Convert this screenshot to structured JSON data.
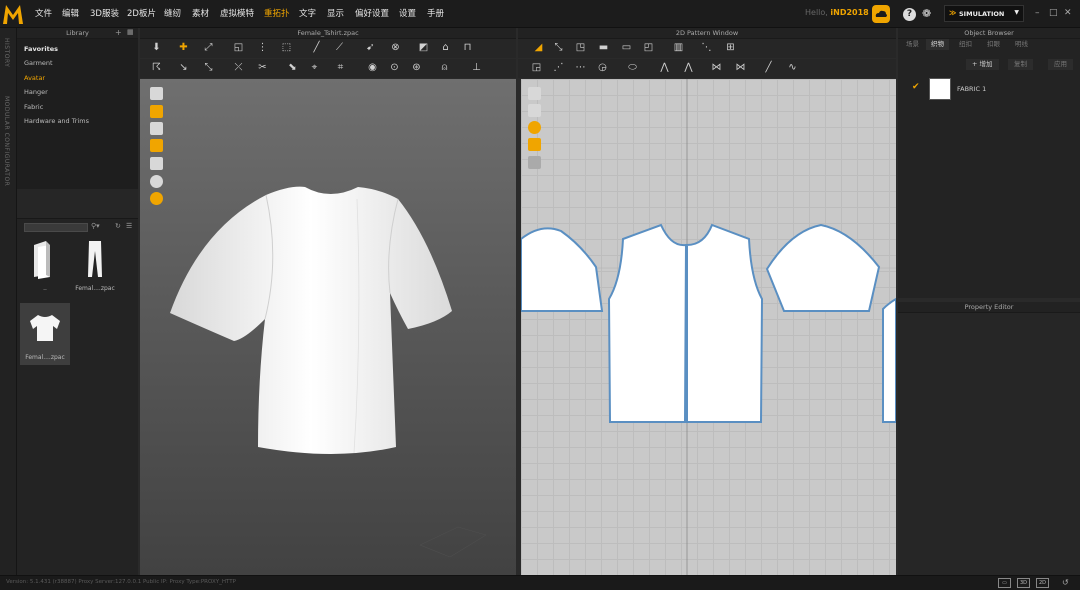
{
  "app": {
    "menus": [
      "文件",
      "编辑",
      "3D服装",
      "2D板片",
      "缝纫",
      "素材",
      "虚拟模特",
      "重拓扑",
      "文字",
      "显示",
      "偏好设置",
      "设置",
      "手册"
    ],
    "active_menu": "重拓扑",
    "user_greeting": "Hello,",
    "user_name": "iND2018",
    "mode": "SIMULATION",
    "accent_color": "#f0a500"
  },
  "left_strip": {
    "history": "HISTORY",
    "modular": "MODULAR CONFIGURATOR"
  },
  "library": {
    "title": "Library",
    "items": [
      "Favorites",
      "Garment",
      "Avatar",
      "Hanger",
      "Fabric",
      "Hardware and Trims"
    ],
    "files": [
      {
        "caption": ".."
      },
      {
        "caption": "Femal....zpac"
      },
      {
        "caption": "Femal....zpac"
      }
    ]
  },
  "view3d": {
    "title": "Female_Tshirt.zpac"
  },
  "view2d": {
    "title": "2D Pattern Window"
  },
  "object_browser": {
    "title": "Object Browser",
    "tabs": [
      "场景",
      "织物",
      "纽扣",
      "扣眼",
      "明线"
    ],
    "active_tab": "织物",
    "buttons": [
      "+ 增加",
      "复制",
      "应用"
    ],
    "fabric_name": "FABRIC 1"
  },
  "property_editor": {
    "title": "Property Editor"
  },
  "status": {
    "text": "Version: 5.1.431 (r38887)   Proxy Server:127.0.0.1   Public IP:   Proxy Type:PROXY_HTTP"
  }
}
